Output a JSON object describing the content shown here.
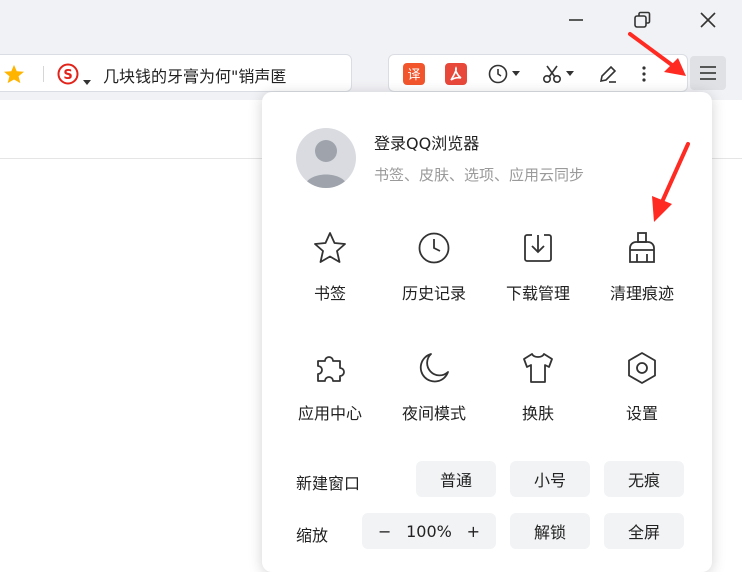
{
  "toolbar": {
    "address_text": "几块钱的牙膏为何\"销声匿"
  },
  "menu": {
    "login": {
      "title": "登录QQ浏览器",
      "subtitle": "书签、皮肤、选项、应用云同步"
    },
    "grid": [
      {
        "label": "书签",
        "icon": "star-icon"
      },
      {
        "label": "历史记录",
        "icon": "clock-icon"
      },
      {
        "label": "下载管理",
        "icon": "download-icon"
      },
      {
        "label": "清理痕迹",
        "icon": "broom-icon"
      },
      {
        "label": "应用中心",
        "icon": "puzzle-icon"
      },
      {
        "label": "夜间模式",
        "icon": "moon-icon"
      },
      {
        "label": "换肤",
        "icon": "shirt-icon"
      },
      {
        "label": "设置",
        "icon": "settings-hexagon-icon"
      }
    ],
    "new_window": {
      "label": "新建窗口",
      "normal": "普通",
      "small": "小号",
      "incognito": "无痕"
    },
    "zoom": {
      "label": "缩放",
      "minus": "−",
      "value": "100%",
      "plus": "+",
      "unlock": "解锁",
      "fullscreen": "全屏"
    }
  },
  "colors": {
    "accent_red": "#ff2a22",
    "translate_orange": "#f2552c",
    "pdf_red": "#e8483a",
    "star_yellow": "#ffb400"
  }
}
